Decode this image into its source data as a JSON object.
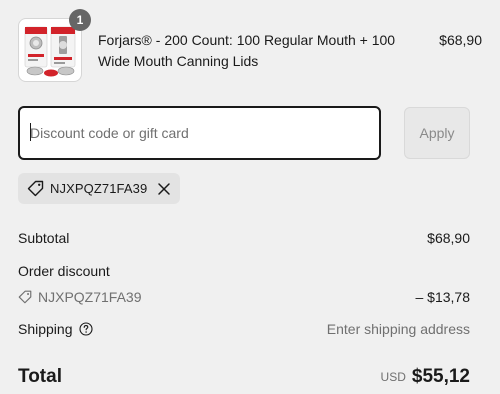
{
  "line_item": {
    "quantity": "1",
    "title": "Forjars® - 200 Count: 100 Regular Mouth + 100 Wide Mouth Canning Lids",
    "price": "$68,90"
  },
  "discount": {
    "placeholder": "Discount code or gift card",
    "value": "",
    "apply_label": "Apply",
    "applied_code": "NJXPQZ71FA39"
  },
  "summary": {
    "subtotal_label": "Subtotal",
    "subtotal_value": "$68,90",
    "order_discount_label": "Order discount",
    "discount_code": "NJXPQZ71FA39",
    "discount_value": "– $13,78",
    "shipping_label": "Shipping",
    "shipping_value": "Enter shipping address",
    "total_label": "Total",
    "currency": "USD",
    "total_value": "$55,12"
  },
  "icons": {
    "chip_tag": "tag-icon",
    "chip_remove": "close-icon",
    "discount_tag": "tag-icon",
    "shipping_help": "question-circle-icon"
  },
  "colors": {
    "background": "#f0f0f0",
    "text": "#1a1a1a",
    "muted_text": "#707070",
    "badge": "#666666",
    "product_accent": "#d2232a"
  }
}
